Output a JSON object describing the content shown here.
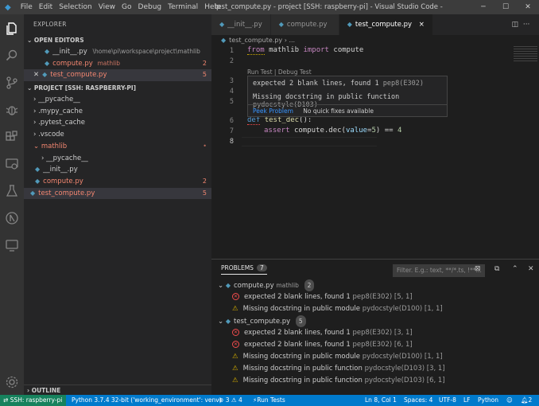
{
  "titlebar": {
    "menu": [
      "File",
      "Edit",
      "Selection",
      "View",
      "Go",
      "Debug",
      "Terminal",
      "Help"
    ],
    "title": "test_compute.py - project [SSH: raspberry-pi] - Visual Studio Code - Insiders"
  },
  "sidebar": {
    "title": "EXPLORER",
    "open_editors": {
      "header": "OPEN EDITORS",
      "items": [
        {
          "name": "__init__.py",
          "path": "\\home\\pi\\workspace\\project\\mathlib",
          "badge": ""
        },
        {
          "name": "compute.py",
          "path": "mathlib",
          "badge": "2"
        },
        {
          "name": "test_compute.py",
          "path": "",
          "badge": "5"
        }
      ]
    },
    "project": {
      "header": "PROJECT [SSH: RASPBERRY-PI]",
      "items": [
        {
          "name": "__pycache__",
          "badge": ""
        },
        {
          "name": ".mypy_cache",
          "badge": ""
        },
        {
          "name": ".pytest_cache",
          "badge": ""
        },
        {
          "name": ".vscode",
          "badge": ""
        },
        {
          "name": "mathlib",
          "badge": "•"
        },
        {
          "name": "__pycache__",
          "badge": ""
        },
        {
          "name": "__init__.py",
          "badge": ""
        },
        {
          "name": "compute.py",
          "badge": "2"
        },
        {
          "name": "test_compute.py",
          "badge": "5"
        }
      ]
    },
    "outline": "OUTLINE"
  },
  "tabs": [
    {
      "label": "__init__.py"
    },
    {
      "label": "compute.py"
    },
    {
      "label": "test_compute.py",
      "close": "×"
    }
  ],
  "breadcrumb": "test_compute.py › ...",
  "code": {
    "line_numbers": [
      "1",
      "2",
      "3",
      "4",
      "5",
      "6",
      "7",
      "8"
    ],
    "line1": {
      "kw1": "from",
      "mod": "mathlib",
      "kw2": "import",
      "name": "compute"
    },
    "line6": {
      "kw": "def",
      "fn": "test_dec",
      "rest": "():"
    },
    "line7": {
      "kw": "assert",
      "pre": "compute.dec(",
      "param": "value",
      "eq": "=",
      "num": "5",
      "post": ") == ",
      "num2": "4"
    },
    "codelens": "Run Test | Debug Test"
  },
  "hover": {
    "msg1": "expected 2 blank lines, found 1",
    "src1": "pep8(E302)",
    "msg2": "Missing docstring in public function",
    "src2": "pydocstyle(D103)",
    "peek": "Peek Problem",
    "nofix": "No quick fixes available"
  },
  "panel": {
    "tab": "PROBLEMS",
    "count": "7",
    "filter_placeholder": "Filter. E.g.: text, **/*.ts, !**...",
    "groups": [
      {
        "file": "compute.py",
        "dir": "mathlib",
        "count": "2",
        "items": [
          {
            "sev": "error",
            "msg": "expected 2 blank lines, found 1",
            "src": "pep8(E302)",
            "pos": "[5, 1]"
          },
          {
            "sev": "warning",
            "msg": "Missing docstring in public module",
            "src": "pydocstyle(D100)",
            "pos": "[1, 1]"
          }
        ]
      },
      {
        "file": "test_compute.py",
        "dir": "",
        "count": "5",
        "items": [
          {
            "sev": "error",
            "msg": "expected 2 blank lines, found 1",
            "src": "pep8(E302)",
            "pos": "[3, 1]"
          },
          {
            "sev": "error",
            "msg": "expected 2 blank lines, found 1",
            "src": "pep8(E302)",
            "pos": "[6, 1]"
          },
          {
            "sev": "warning",
            "msg": "Missing docstring in public module",
            "src": "pydocstyle(D100)",
            "pos": "[1, 1]"
          },
          {
            "sev": "warning",
            "msg": "Missing docstring in public function",
            "src": "pydocstyle(D103)",
            "pos": "[3, 1]"
          },
          {
            "sev": "warning",
            "msg": "Missing docstring in public function",
            "src": "pydocstyle(D103)",
            "pos": "[6, 1]"
          }
        ]
      }
    ]
  },
  "statusbar": {
    "ssh": "SSH: raspberry-pi",
    "python": "Python 3.7.4 32-bit ('working_environment': venv)",
    "errors": "3",
    "warnings": "4",
    "run_tests": "Run Tests",
    "position": "Ln 8, Col 1",
    "spaces": "Spaces: 4",
    "encoding": "UTF-8",
    "eol": "LF",
    "language": "Python",
    "notifications": "2"
  },
  "colors": {
    "accent": "#007acc",
    "remote": "#16825d",
    "error": "#f48771",
    "warning": "#cca700"
  }
}
